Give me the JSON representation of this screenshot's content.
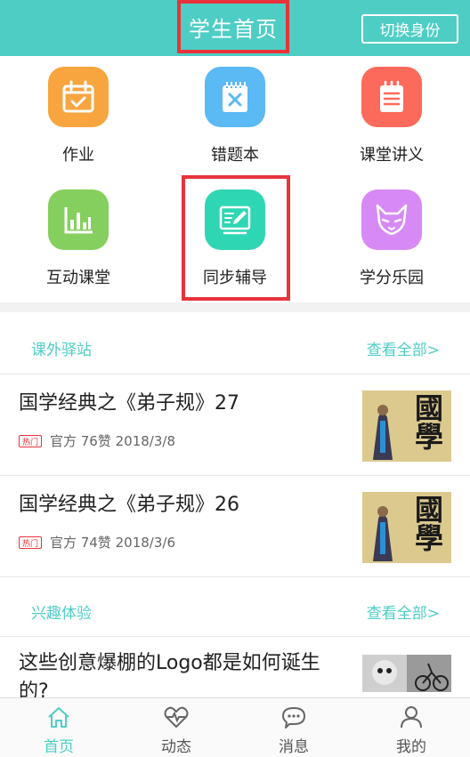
{
  "header": {
    "title": "学生首页",
    "switch_label": "切换身份",
    "bg_color": "#4ecdc4",
    "highlight_color": "#e8333a"
  },
  "grid": [
    {
      "label": "作业",
      "icon": "homework-calendar-icon",
      "color": "#f8a53f"
    },
    {
      "label": "错题本",
      "icon": "error-notebook-icon",
      "color": "#5bb9f4"
    },
    {
      "label": "课堂讲义",
      "icon": "notes-list-icon",
      "color": "#fb6a5a"
    },
    {
      "label": "互动课堂",
      "icon": "bar-chart-icon",
      "color": "#84cf5d"
    },
    {
      "label": "同步辅导",
      "icon": "edit-board-icon",
      "color": "#2fd6b4"
    },
    {
      "label": "学分乐园",
      "icon": "fox-icon",
      "color": "#d78af5"
    }
  ],
  "sections": {
    "extracurricular": {
      "title": "课外驿站",
      "more": "查看全部>",
      "articles": [
        {
          "title": "国学经典之《弟子规》27",
          "badge": "热门",
          "meta": "官方 76赞 2018/3/8"
        },
        {
          "title": "国学经典之《弟子规》26",
          "badge": "热门",
          "meta": "官方 74赞 2018/3/6"
        }
      ]
    },
    "interest": {
      "title": "兴趣体验",
      "more": "查看全部>",
      "articles": [
        {
          "title": "这些创意爆棚的Logo都是如何诞生的?"
        }
      ]
    }
  },
  "thumb_text": "國學",
  "tabs": [
    {
      "label": "首页",
      "icon": "home-icon",
      "active": true
    },
    {
      "label": "动态",
      "icon": "heartbeat-icon",
      "active": false
    },
    {
      "label": "消息",
      "icon": "chat-bubble-icon",
      "active": false
    },
    {
      "label": "我的",
      "icon": "user-icon",
      "active": false
    }
  ],
  "accent_color": "#4ecdc4"
}
